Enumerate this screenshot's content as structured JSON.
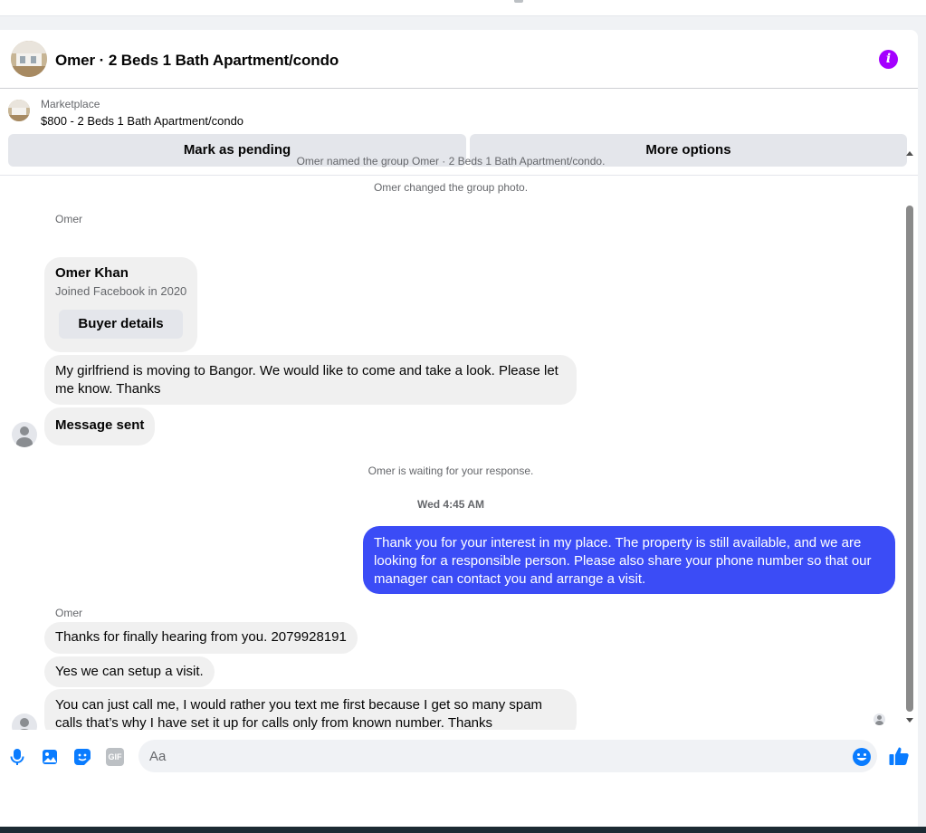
{
  "header": {
    "title": "Omer · 2 Beds 1 Bath Apartment/condo",
    "info_icon": "info-icon",
    "accent_color": "#a400ff"
  },
  "marketplace": {
    "label": "Marketplace",
    "listing": "$800 - 2 Beds 1 Bath Apartment/condo",
    "mark_pending_label": "Mark as pending",
    "more_options_label": "More options"
  },
  "chat": {
    "system_named": "Omer named the group Omer · 2 Beds 1 Bath Apartment/condo.",
    "system_photo": "Omer changed the group photo.",
    "sender_1": "Omer",
    "buyer_card": {
      "name": "Omer Khan",
      "since": "Joined Facebook in 2020",
      "button": "Buyer details"
    },
    "msg_1": "My girlfriend is moving to Bangor. We would like to come and take a look. Please let me know. Thanks",
    "msg_2": "Message sent",
    "waiting": "Omer is waiting for your response.",
    "timestamp": "Wed 4:45 AM",
    "outgoing": "Thank you for your interest in my place. The property is still available, and we are looking for a responsible person. Please also share your phone number so that our manager can contact you and arrange a visit.",
    "sender_2": "Omer",
    "msg_3": "Thanks for finally hearing from you.  2079928191",
    "msg_4": "Yes we can setup  a visit.",
    "msg_5": "You can just call me, I would rather you text me first because  I get so many spam calls that’s why I have set it up for calls only from known number. Thanks",
    "outgoing_color": "#3b4cf6"
  },
  "composer": {
    "placeholder": "Aa",
    "icons": [
      "microphone-icon",
      "image-icon",
      "sticker-icon",
      "gif-icon",
      "emoji-icon",
      "thumbs-up-icon"
    ],
    "gif_label": "GIF",
    "accent_color": "#0a7cff"
  }
}
